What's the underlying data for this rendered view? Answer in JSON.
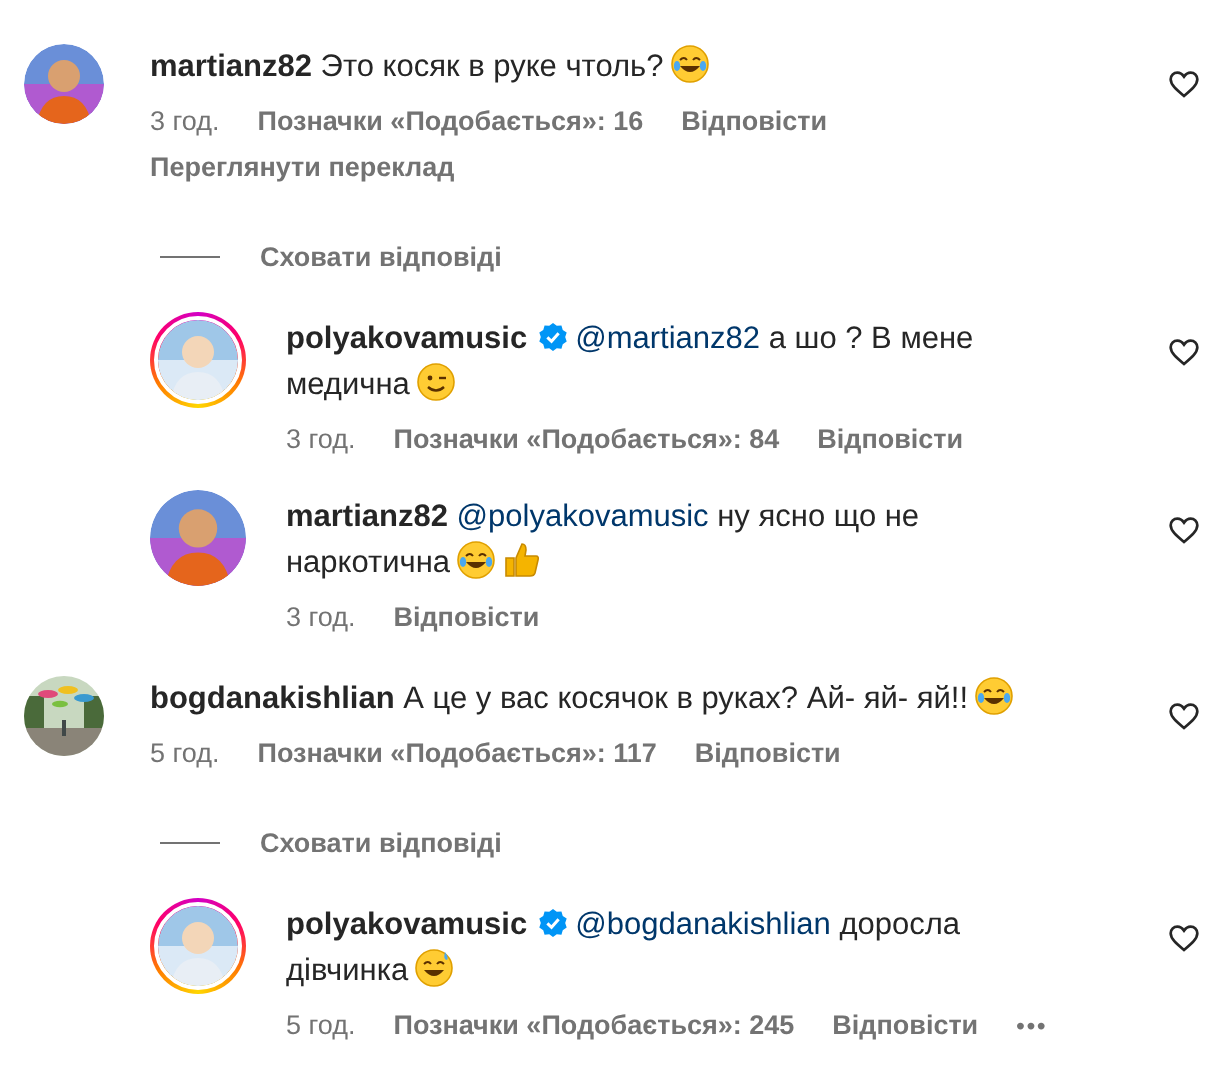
{
  "comments": [
    {
      "author": "martianz82",
      "verified": false,
      "story_ring": false,
      "avatar": {
        "kind": "person"
      },
      "text": "Это косяк в руке чтоль?",
      "emojis": [
        {
          "kind": "tears-of-joy"
        }
      ],
      "time": "3 год.",
      "likes": "Позначки «Подобається»: 16",
      "reply": "Відповісти",
      "translate": "Переглянути переклад",
      "hide_replies": "Сховати відповіді",
      "replies": [
        {
          "author": "polyakovamusic",
          "verified": true,
          "story_ring": true,
          "avatar": {
            "kind": "person"
          },
          "mention": "@martianz82",
          "text": "а шо ? В мене медична",
          "emojis": [
            {
              "kind": "wink"
            }
          ],
          "time": "3 год.",
          "likes": "Позначки «Подобається»: 84",
          "reply": "Відповісти"
        },
        {
          "author": "martianz82",
          "verified": false,
          "story_ring": false,
          "avatar": {
            "kind": "person"
          },
          "mention": "@polyakovamusic",
          "text": "ну ясно що не наркотична",
          "emojis": [
            {
              "kind": "tears-of-joy"
            },
            {
              "kind": "thumbs-up"
            }
          ],
          "time": "3 год.",
          "reply": "Відповісти"
        }
      ]
    },
    {
      "author": "bogdanakishlian",
      "verified": false,
      "story_ring": false,
      "avatar": {
        "kind": "picture"
      },
      "text": "А це у вас косячок в руках? Ай- яй- яй!!",
      "emojis": [
        {
          "kind": "tears-of-joy"
        }
      ],
      "time": "5 год.",
      "likes": "Позначки «Подобається»: 117",
      "reply": "Відповісти",
      "hide_replies": "Сховати відповіді",
      "replies": [
        {
          "author": "polyakovamusic",
          "verified": true,
          "story_ring": true,
          "avatar": {
            "kind": "person"
          },
          "mention": "@bogdanakishlian",
          "text": "доросла дівчинка",
          "emojis": [
            {
              "kind": "sweat-smile"
            }
          ],
          "time": "5 год.",
          "likes": "Позначки «Подобається»: 245",
          "reply": "Відповісти",
          "more": "•••"
        }
      ]
    }
  ]
}
